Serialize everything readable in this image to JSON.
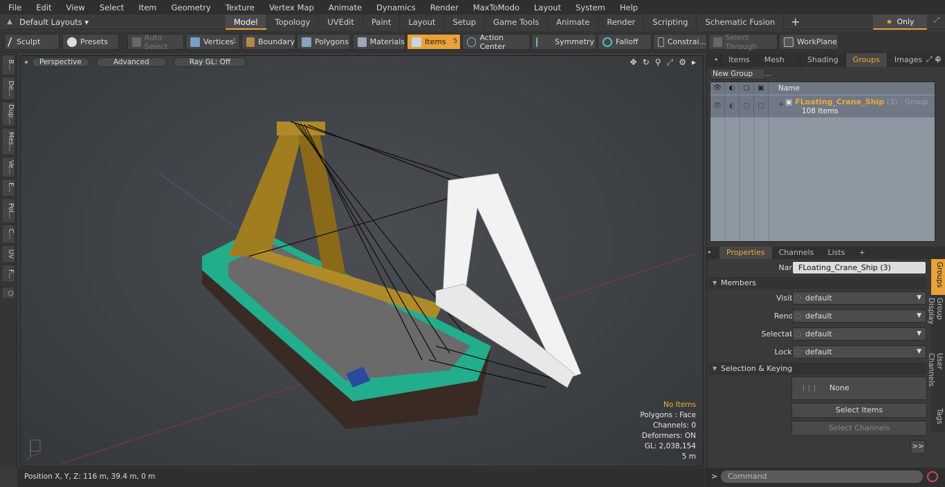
{
  "menu": [
    "File",
    "Edit",
    "View",
    "Select",
    "Item",
    "Geometry",
    "Texture",
    "Vertex Map",
    "Animate",
    "Dynamics",
    "Render",
    "MaxToModo",
    "Layout",
    "System",
    "Help"
  ],
  "layout": {
    "preset": "Default Layouts ▾",
    "tabs": [
      "Model",
      "Topology",
      "UVEdit",
      "Paint",
      "Layout",
      "Setup",
      "Game Tools",
      "Animate",
      "Render",
      "Scripting",
      "Schematic Fusion"
    ],
    "active_tab": "Model",
    "only_label": "Only"
  },
  "toolbar": {
    "sculpt": "Sculpt",
    "presets": "Presets",
    "auto_select": "Auto Select",
    "vertices": "Vertices",
    "vertices_count": "1",
    "boundary": "Boundary",
    "polygons": "Polygons",
    "materials": "Materials",
    "items": "Items",
    "items_count": "5",
    "action_center": "Action Center",
    "symmetry": "Symmetry",
    "falloff": "Falloff",
    "constraints": "Constrai...",
    "select_through": "Select Through",
    "workplane": "WorkPlane"
  },
  "left_tabs": [
    "B...",
    "De...",
    "Dup...",
    "Mes...",
    "Ve...",
    "E...",
    "Pol...",
    "C...",
    "UV",
    "F..."
  ],
  "viewport": {
    "view_mode": "Perspective",
    "shading": "Advanced",
    "raygl": "Ray GL: Off",
    "info": {
      "selection": "No Items",
      "polygons": "Polygons : Face",
      "channels": "Channels: 0",
      "deformers": "Deformers: ON",
      "gl": "GL: 2,038,154",
      "scale": "5 m"
    }
  },
  "status": {
    "position": "Position X, Y, Z:   116 m, 39.4 m, 0 m"
  },
  "right_panel": {
    "tabs": [
      "Items",
      "Mesh ...",
      "Shading",
      "Groups",
      "Images"
    ],
    "active_tab": "Groups",
    "new_group": "New Group",
    "list_header": "Name",
    "group": {
      "name": "FLoating_Crane_Ship",
      "suffix": " (3) : Group",
      "items": "108 Items"
    }
  },
  "properties": {
    "tabs": [
      "Properties",
      "Channels",
      "Lists"
    ],
    "active_tab": "Properties",
    "name_label": "Name",
    "name_value": "FLoating_Crane_Ship (3)",
    "members_section": "Members",
    "visible_label": "Visible",
    "visible_value": "default",
    "render_label": "Render",
    "render_value": "default",
    "selectable_label": "Selectable",
    "selectable_value": "default",
    "locked_label": "Locked",
    "locked_value": "default",
    "selection_section": "Selection & Keying",
    "none_button": "None",
    "select_items": "Select Items",
    "select_channels": "Select Channels",
    "more": ">>",
    "side_tabs": [
      "Groups",
      "Group Display",
      "User Channels",
      "Tags"
    ]
  },
  "command": {
    "placeholder": "Command"
  },
  "colors": {
    "accent": "#e8a23a",
    "crane_gold": "#a07d1e",
    "hull_teal": "#1fc4a0"
  }
}
